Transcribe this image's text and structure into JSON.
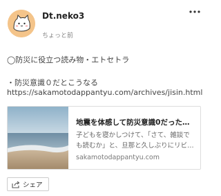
{
  "post": {
    "author": "Dt.neko3",
    "timestamp": "ちょっと前",
    "body_line1": "◯防災に役立つ読み物・エトセトラ",
    "body_line2": "・防災意識０だとこうなる",
    "link_url": "https://sakamotodappantyu.com/archives/jisin.html"
  },
  "preview": {
    "title": "地震を体感して防災意識0だったこ…",
    "description": "子どもを寝かしつけて、「さて、雑談でも読むか」と、旦那と久しぶりにリビ…",
    "domain": "sakamotodappantyu.com"
  },
  "actions": {
    "share_label": "シェア",
    "more_icon": "more-options-icon"
  }
}
